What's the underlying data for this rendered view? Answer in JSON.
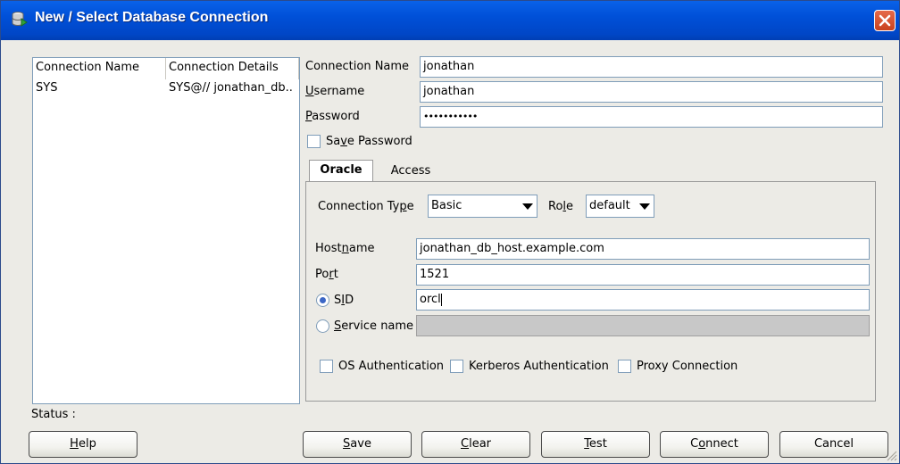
{
  "window": {
    "title": "New / Select Database Connection"
  },
  "connections": {
    "headers": [
      "Connection Name",
      "Connection Details"
    ],
    "rows": [
      {
        "name": "SYS",
        "details": "SYS@// jonathan_db.."
      }
    ]
  },
  "form": {
    "connection_name_label": "Connection Name",
    "connection_name_value": "jonathan",
    "username_label": "Username",
    "username_value": "jonathan",
    "password_label": "Password",
    "password_value": "•••••••••••",
    "save_password_label": "Save Password"
  },
  "tabs": [
    {
      "label": "Oracle",
      "active": true
    },
    {
      "label": "Access",
      "active": false
    }
  ],
  "oracle": {
    "connection_type_label": "Connection Type",
    "connection_type_value": "Basic",
    "role_label": "Role",
    "role_value": "default",
    "hostname_label": "Hostname",
    "hostname_value": "jonathan_db_host.example.com",
    "port_label": "Port",
    "port_value": "1521",
    "sid_label": "SID",
    "sid_value": "orcl",
    "service_name_label": "Service name",
    "service_name_value": "",
    "os_auth_label": "OS Authentication",
    "kerberos_label": "Kerberos Authentication",
    "proxy_label": "Proxy Connection"
  },
  "status": {
    "label": "Status :"
  },
  "buttons": {
    "help": "Help",
    "save": "Save",
    "clear": "Clear",
    "test": "Test",
    "connect": "Connect",
    "cancel": "Cancel"
  },
  "colors": {
    "titlebar": "#0050d8",
    "close_button": "#c9421e",
    "window_bg": "#ecebe6",
    "field_border": "#7f9db9"
  }
}
